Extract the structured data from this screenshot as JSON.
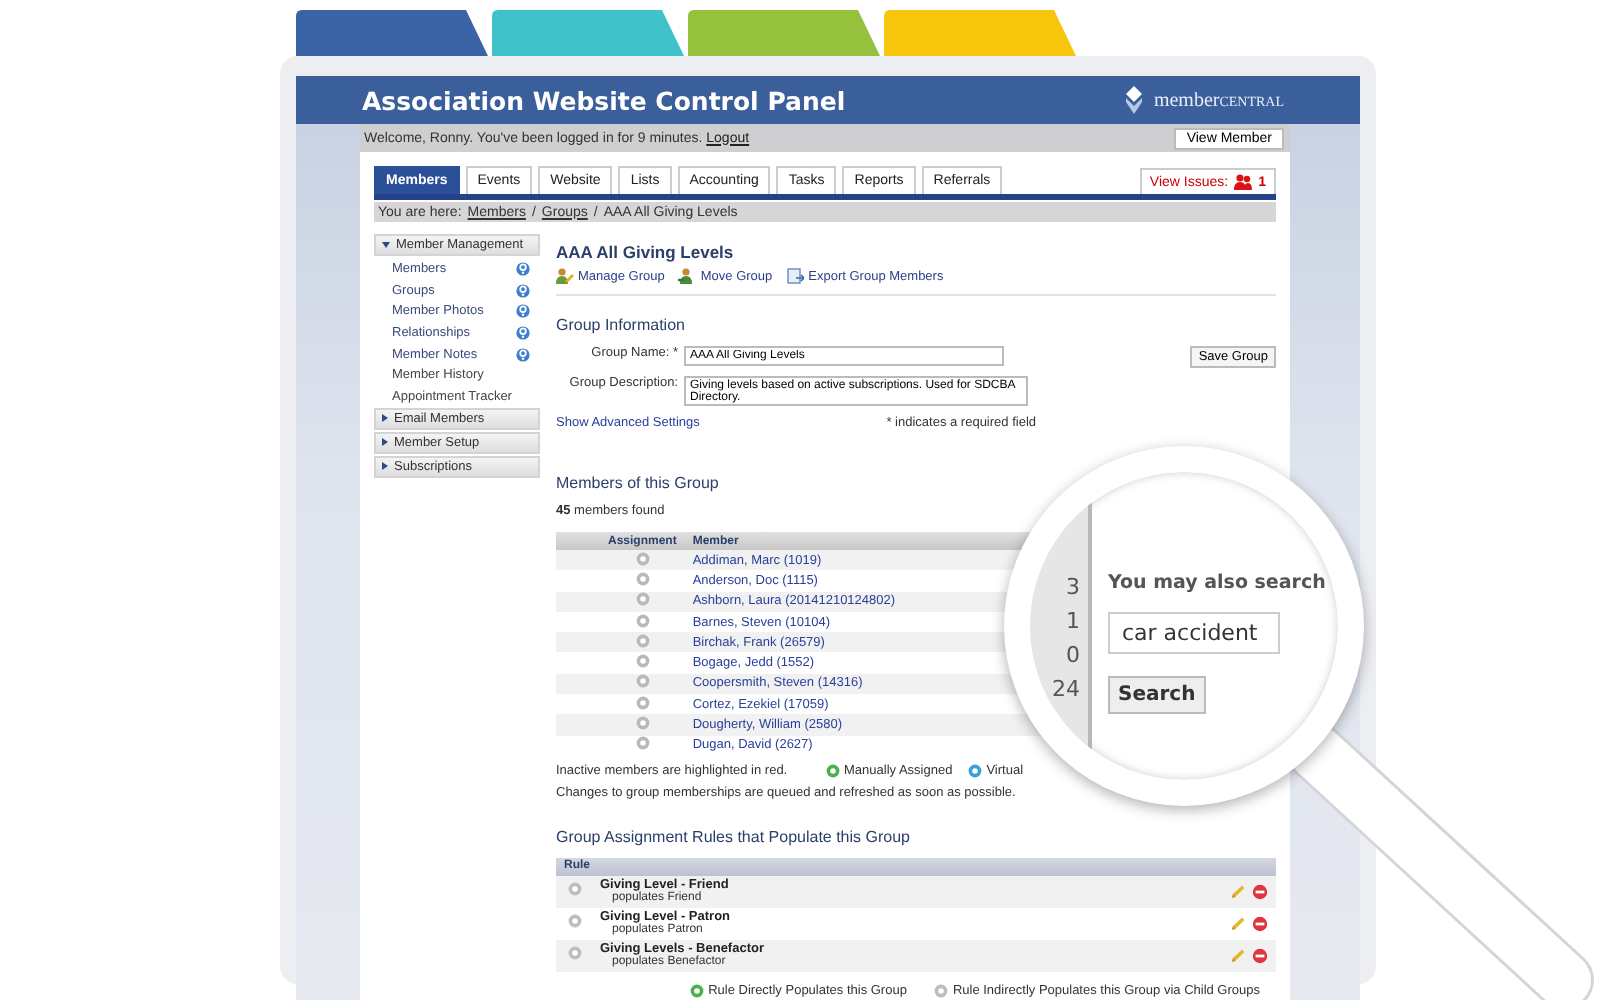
{
  "header": {
    "title": "Association Website Control Panel",
    "logo": {
      "word": "member",
      "suffix": "CENTRAL"
    }
  },
  "welcome_bar": {
    "message": "Welcome, Ronny. You've been logged in for 9 minutes.",
    "logout": "Logout",
    "button": "View Member"
  },
  "nav_tabs": [
    {
      "label": "Members",
      "selected": true
    },
    {
      "label": "Events",
      "selected": false
    },
    {
      "label": "Website",
      "selected": false
    },
    {
      "label": "Lists",
      "selected": false
    },
    {
      "label": "Accounting",
      "selected": false
    },
    {
      "label": "Tasks",
      "selected": false
    },
    {
      "label": "Reports",
      "selected": false
    },
    {
      "label": "Referrals",
      "selected": false
    }
  ],
  "issues": {
    "label": "View Issues:",
    "count": "1"
  },
  "breadcrumb": [
    {
      "kind": "label",
      "text": "You are here:"
    },
    {
      "kind": "link",
      "text": "Members"
    },
    {
      "kind": "separator",
      "text": "/"
    },
    {
      "kind": "link",
      "text": "Groups"
    },
    {
      "kind": "separator",
      "text": "/"
    },
    {
      "kind": "current",
      "text": "AAA All Giving Levels"
    }
  ],
  "sidebar": [
    {
      "label": "Member Management",
      "expanded": true,
      "children": [
        {
          "label": "Members",
          "help": true
        },
        {
          "label": "Groups",
          "help": true
        },
        {
          "label": "Member Photos",
          "help": true
        },
        {
          "label": "Relationships",
          "help": true
        },
        {
          "label": "Member Notes",
          "help": true
        },
        {
          "label": "Member History",
          "help": false
        },
        {
          "label": "Appointment Tracker",
          "help": false
        }
      ]
    },
    {
      "label": "Email Members",
      "expanded": false
    },
    {
      "label": "Member Setup",
      "expanded": false
    },
    {
      "label": "Subscriptions",
      "expanded": false
    }
  ],
  "main": {
    "title": "AAA All Giving Levels",
    "actions": [
      {
        "label": "Manage Group",
        "kind": "manage"
      },
      {
        "label": "Move Group",
        "kind": "move"
      },
      {
        "label": "Export Group Members",
        "kind": "export"
      }
    ],
    "group_info": {
      "heading": "Group Information",
      "fields": [
        {
          "label": "Group Name:",
          "required_mark": "*",
          "value": "AAA All Giving Levels",
          "kind": "text"
        },
        {
          "label": "Group Description:",
          "value": "Giving levels based on active subscriptions. Used for SDCBA Directory.",
          "kind": "textarea"
        }
      ],
      "save_button": "Save Group",
      "advanced_link": "Show Advanced Settings",
      "required_note": "* indicates a required field"
    },
    "members": {
      "heading": "Members of this Group",
      "count": "**45** members found",
      "columns": [
        "Assignment",
        "Member"
      ],
      "rows": [
        "Addiman, Marc (1019)",
        "Anderson, Doc (1115)",
        "Ashborn, Laura (20141210124802)",
        "Barnes, Steven (10104)",
        "Birchak, Frank (26579)",
        "Bogage, Jedd (1552)",
        "Coopersmith, Steven (14316)",
        "Cortez, Ezekiel (17059)",
        "Dougherty, William (2580)",
        "Dugan, David (2627)"
      ],
      "note": "Inactive members are highlighted in red.",
      "legend": [
        {
          "label": "Manually Assigned",
          "color": "#4caf50"
        },
        {
          "label": "Virtual",
          "color": "#3aa0d8"
        }
      ],
      "queue_note": "Changes to group memberships are queued and refreshed as soon as possible."
    },
    "rules": {
      "heading": "Group Assignment Rules that Populate this Group",
      "columns": [
        "Rule"
      ],
      "rows": [
        {
          "name": "Giving Level - Friend",
          "detail": "populates Friend"
        },
        {
          "name": "Giving Level - Patron",
          "detail": "populates Patron"
        },
        {
          "name": "Giving Levels - Benefactor",
          "detail": "populates Benefactor"
        }
      ],
      "legend": [
        {
          "label": "Rule Directly Populates this Group",
          "color": "#4caf50"
        },
        {
          "label": "Rule Indirectly Populates this Group via Child Groups",
          "color": "#bdbdbd"
        }
      ]
    }
  },
  "magnifier": {
    "numbers": [
      "3",
      "1",
      "0",
      "24"
    ],
    "prompt": "You may also search",
    "search_value": "car accident",
    "search_button": "Search"
  }
}
